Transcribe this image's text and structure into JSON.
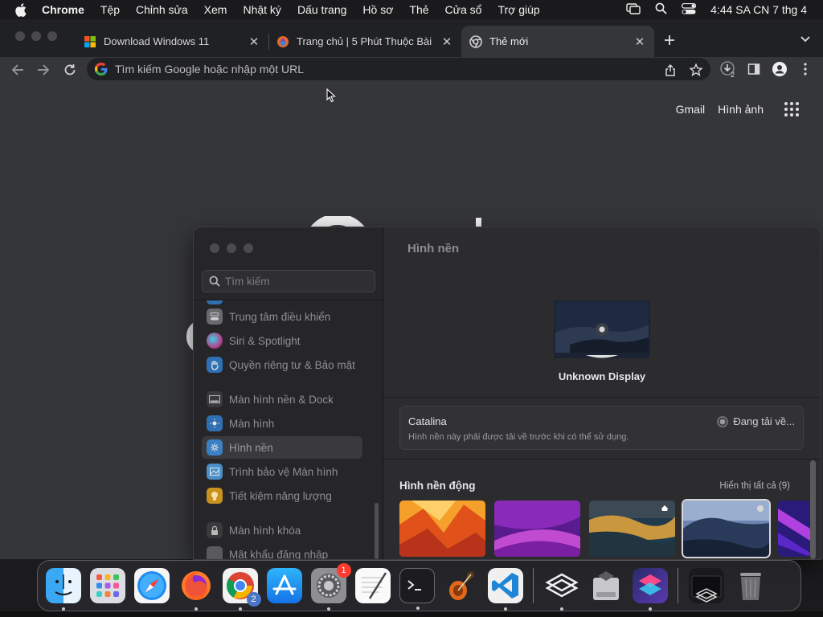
{
  "menubar": {
    "app_name": "Chrome",
    "menus": [
      "Tệp",
      "Chỉnh sửa",
      "Xem",
      "Nhật ký",
      "Dấu trang",
      "Hồ sơ",
      "Thẻ",
      "Cửa sổ",
      "Trợ giúp"
    ],
    "clock": "4:44 SA CN 7 thg 4",
    "status_icons": [
      "screen-mirroring-icon",
      "spotlight-search-icon",
      "control-center-icon"
    ]
  },
  "chrome": {
    "tabs": [
      {
        "title": "Download Windows 11",
        "favicon": "windows-logo-icon",
        "active": false
      },
      {
        "title": "Trang chủ | 5 Phút Thuộc Bài",
        "favicon": "site-favicon-icon",
        "active": false
      },
      {
        "title": "Thẻ mới",
        "favicon": "chrome-logo-icon",
        "active": true
      }
    ],
    "omnibox": {
      "placeholder": "Tìm kiếm Google hoặc nhập một URL",
      "value": ""
    },
    "toolbar_icons": [
      "share-icon",
      "bookmark-star-icon",
      "downloads-icon",
      "side-panel-icon",
      "profile-icon",
      "more-menu-icon"
    ],
    "downloads_count": "2",
    "newtab": {
      "links": [
        "Gmail",
        "Hình ảnh"
      ],
      "apps_icon": "google-apps-icon"
    }
  },
  "settings": {
    "search_placeholder": "Tìm kiếm",
    "sidebar_items": [
      {
        "label": "Trung tâm điều khiển",
        "icon": "control-center-icon",
        "color": "#6a6a6e"
      },
      {
        "label": "Siri & Spotlight",
        "icon": "siri-icon",
        "color": "#b4448a"
      },
      {
        "label": "Quyền riêng tư & Bảo mật",
        "icon": "privacy-hand-icon",
        "color": "#2f6fb3"
      },
      {
        "label": "Màn hình nền & Dock",
        "icon": "desktop-dock-icon",
        "color": "#3a3a3d"
      },
      {
        "label": "Màn hình",
        "icon": "display-brightness-icon",
        "color": "#2f6fb3"
      },
      {
        "label": "Hình nền",
        "icon": "wallpaper-icon",
        "color": "#3b7fc4"
      },
      {
        "label": "Trình bảo vệ Màn hình",
        "icon": "screensaver-icon",
        "color": "#4a90c8"
      },
      {
        "label": "Tiết kiệm năng lượng",
        "icon": "energy-bulb-icon",
        "color": "#c9911f"
      },
      {
        "label": "Màn hình khóa",
        "icon": "lock-screen-icon",
        "color": "#3a3a3d"
      },
      {
        "label": "Mật khẩu đăng nhập",
        "icon": "login-password-icon",
        "color": "#5a5a5e"
      }
    ],
    "selected_item": "Hình nền",
    "pane": {
      "title": "Hình nền",
      "display_name": "Unknown Display",
      "current_wallpaper": {
        "name": "Catalina",
        "description": "Hình nền này phải được tải về trước khi có thể sử dụng.",
        "status": "Đang tải về..."
      },
      "section_title": "Hình nền động",
      "show_all": "Hiển thị tất cả (9)",
      "thumbnails": [
        {
          "name": "ventura-orange-wallpaper",
          "colors": [
            "#f6a02c",
            "#e0521a",
            "#b8331a"
          ]
        },
        {
          "name": "monterey-purple-wallpaper",
          "colors": [
            "#8a2ab8",
            "#5a1b8e",
            "#c04bd0"
          ]
        },
        {
          "name": "catalina-coast-wallpaper",
          "colors": [
            "#3b4a55",
            "#c9973e",
            "#1f3a4a"
          ]
        },
        {
          "name": "catalina-island-wallpaper",
          "colors": [
            "#2a3a5a",
            "#6b84b0",
            "#182236"
          ]
        },
        {
          "name": "abstract-purple-wallpaper",
          "colors": [
            "#5a28c8",
            "#b040e0",
            "#2a1a7a"
          ]
        }
      ]
    }
  },
  "dock": {
    "apps": [
      {
        "name": "finder",
        "running": true
      },
      {
        "name": "launchpad",
        "running": false
      },
      {
        "name": "safari",
        "running": false
      },
      {
        "name": "firefox",
        "running": true
      },
      {
        "name": "chrome",
        "running": true,
        "badge": "2"
      },
      {
        "name": "app-store",
        "running": false
      },
      {
        "name": "system-settings",
        "running": true,
        "badge": "1"
      },
      {
        "name": "textedit",
        "running": false
      },
      {
        "name": "terminal",
        "running": true
      },
      {
        "name": "garageband",
        "running": false
      },
      {
        "name": "vscode",
        "running": true
      }
    ],
    "apps_right": [
      {
        "name": "ivpn",
        "running": true
      },
      {
        "name": "disk-utility",
        "running": false
      },
      {
        "name": "shortcuts",
        "running": true
      }
    ],
    "stack": [
      {
        "name": "downloads-stack"
      },
      {
        "name": "trash"
      }
    ]
  }
}
